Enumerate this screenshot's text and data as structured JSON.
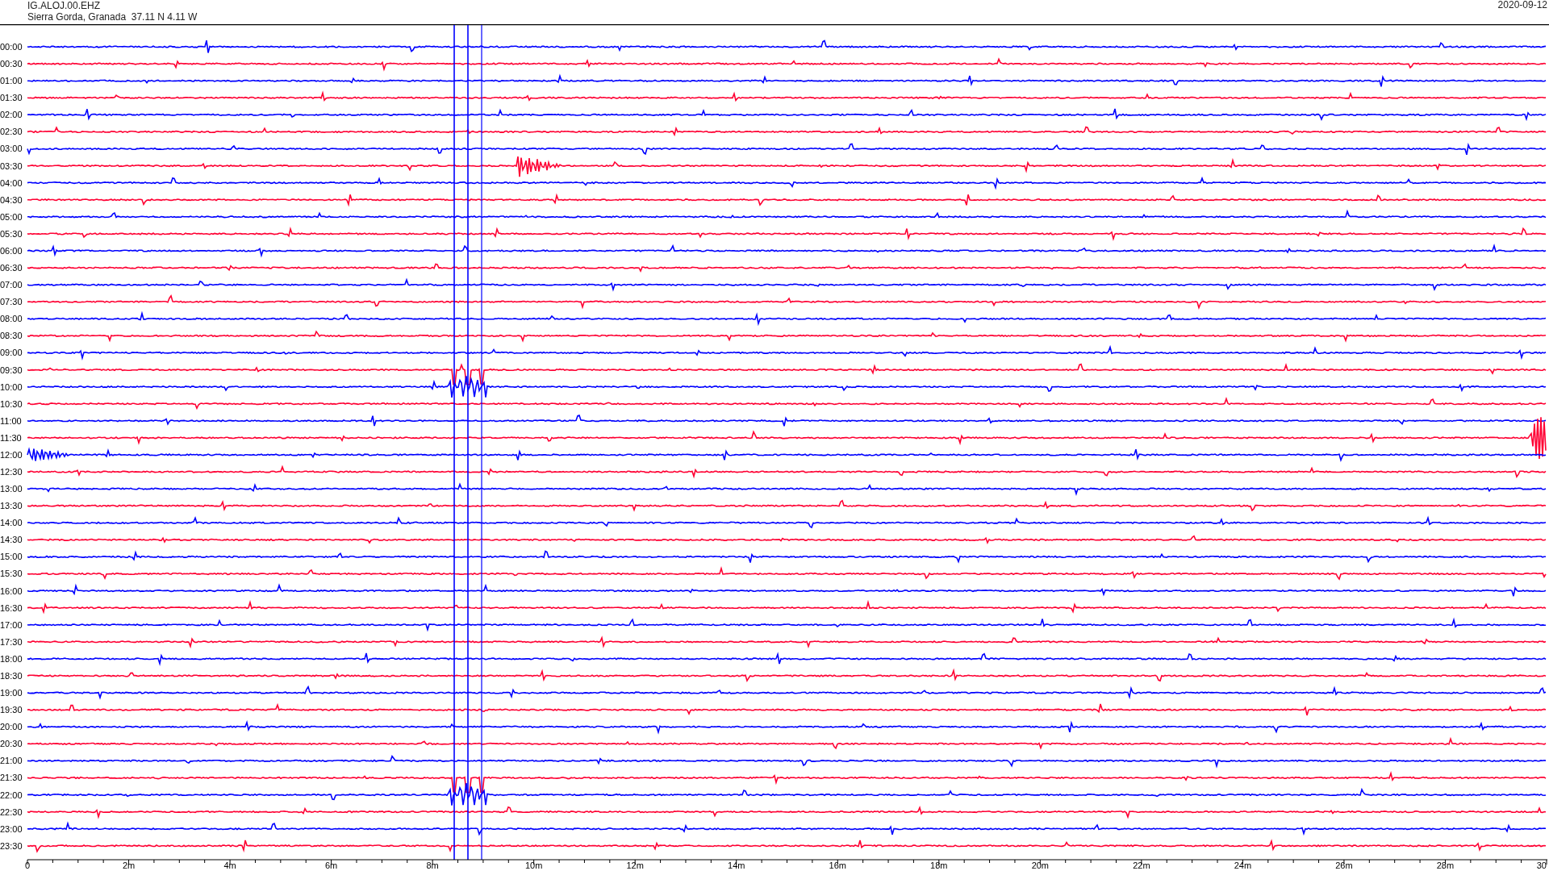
{
  "header": {
    "station": "IG.ALOJ.00.EHZ",
    "location": "Sierra Gorda, Granada  37.11 N 4.11 W",
    "date": "2020-09-12"
  },
  "traces": [
    {
      "label": "00:00",
      "color": "#0000ff"
    },
    {
      "label": "00:30",
      "color": "#ff0033"
    },
    {
      "label": "01:00",
      "color": "#0000ff"
    },
    {
      "label": "01:30",
      "color": "#ff0033"
    },
    {
      "label": "02:00",
      "color": "#0000ff"
    },
    {
      "label": "02:30",
      "color": "#ff0033"
    },
    {
      "label": "03:00",
      "color": "#0000ff"
    },
    {
      "label": "03:30",
      "color": "#ff0033"
    },
    {
      "label": "04:00",
      "color": "#0000ff"
    },
    {
      "label": "04:30",
      "color": "#ff0033"
    },
    {
      "label": "05:00",
      "color": "#0000ff"
    },
    {
      "label": "05:30",
      "color": "#ff0033"
    },
    {
      "label": "06:00",
      "color": "#0000ff"
    },
    {
      "label": "06:30",
      "color": "#ff0033"
    },
    {
      "label": "07:00",
      "color": "#0000ff"
    },
    {
      "label": "07:30",
      "color": "#ff0033"
    },
    {
      "label": "08:00",
      "color": "#0000ff"
    },
    {
      "label": "08:30",
      "color": "#ff0033"
    },
    {
      "label": "09:00",
      "color": "#0000ff"
    },
    {
      "label": "09:30",
      "color": "#ff0033"
    },
    {
      "label": "10:00",
      "color": "#0000ff"
    },
    {
      "label": "10:30",
      "color": "#ff0033"
    },
    {
      "label": "11:00",
      "color": "#0000ff"
    },
    {
      "label": "11:30",
      "color": "#ff0033"
    },
    {
      "label": "12:00",
      "color": "#0000ff"
    },
    {
      "label": "12:30",
      "color": "#ff0033"
    },
    {
      "label": "13:00",
      "color": "#0000ff"
    },
    {
      "label": "13:30",
      "color": "#ff0033"
    },
    {
      "label": "14:00",
      "color": "#0000ff"
    },
    {
      "label": "14:30",
      "color": "#ff0033"
    },
    {
      "label": "15:00",
      "color": "#0000ff"
    },
    {
      "label": "15:30",
      "color": "#ff0033"
    },
    {
      "label": "16:00",
      "color": "#0000ff"
    },
    {
      "label": "16:30",
      "color": "#ff0033"
    },
    {
      "label": "17:00",
      "color": "#0000ff"
    },
    {
      "label": "17:30",
      "color": "#ff0033"
    },
    {
      "label": "18:00",
      "color": "#0000ff"
    },
    {
      "label": "18:30",
      "color": "#ff0033"
    },
    {
      "label": "19:00",
      "color": "#0000ff"
    },
    {
      "label": "19:30",
      "color": "#ff0033"
    },
    {
      "label": "20:00",
      "color": "#0000ff"
    },
    {
      "label": "20:30",
      "color": "#ff0033"
    },
    {
      "label": "21:00",
      "color": "#0000ff"
    },
    {
      "label": "21:30",
      "color": "#ff0033"
    },
    {
      "label": "22:00",
      "color": "#0000ff"
    },
    {
      "label": "22:30",
      "color": "#ff0033"
    },
    {
      "label": "23:00",
      "color": "#0000ff"
    },
    {
      "label": "23:30",
      "color": "#ff0033"
    }
  ],
  "x_axis": {
    "labels": [
      "0",
      "2m",
      "4m",
      "6m",
      "8m",
      "10m",
      "12m",
      "14m",
      "16m",
      "18m",
      "20m",
      "22m",
      "24m",
      "26m",
      "28m",
      "30"
    ]
  }
}
